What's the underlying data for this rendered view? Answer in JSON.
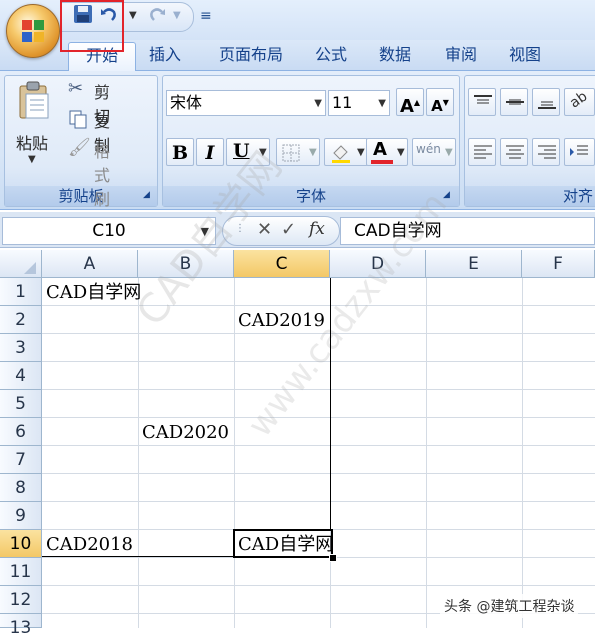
{
  "quick_access": {
    "save_icon": "save-icon",
    "undo_icon": "undo-icon",
    "redo_icon": "redo-icon",
    "customize_icon": "customize-qat-icon"
  },
  "tabs": [
    "开始",
    "插入",
    "页面布局",
    "公式",
    "数据",
    "审阅",
    "视图"
  ],
  "ribbon": {
    "clipboard": {
      "paste": "粘贴",
      "cut": "剪切",
      "copy": "复制",
      "format_painter": "格式刷",
      "group_label": "剪贴板"
    },
    "font": {
      "font_name": "宋体",
      "font_size": "11",
      "bold": "B",
      "italic": "I",
      "underline": "U",
      "font_color_letter": "A",
      "font_color": "#e2242b",
      "phonetic": "wén",
      "group_label": "字体"
    },
    "alignment": {
      "group_label": "对齐"
    }
  },
  "formula_bar": {
    "name_box": "C10",
    "fx": "fx",
    "content": "CAD自学网"
  },
  "sheet": {
    "columns": [
      "A",
      "B",
      "C",
      "D",
      "E",
      "F"
    ],
    "rows": [
      "1",
      "2",
      "3",
      "4",
      "5",
      "6",
      "7",
      "8",
      "9",
      "10",
      "11",
      "12",
      "13"
    ],
    "cells": {
      "A1": "CAD自学网",
      "C2": "CAD2019",
      "B6": "CAD2020",
      "A10": "CAD2018",
      "C10": "CAD自学网"
    },
    "selected_cell": "C10"
  },
  "watermark": {
    "line1": "CAD自学网",
    "line2": "www.cadzxw.com"
  },
  "footer_credit": "头条 @建筑工程杂谈"
}
